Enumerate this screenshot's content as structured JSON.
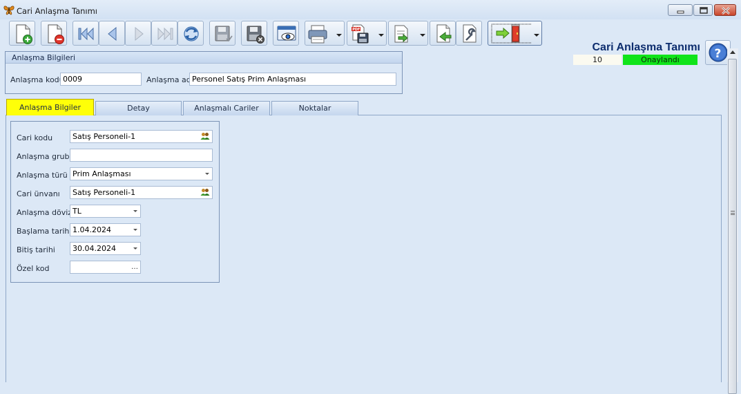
{
  "window": {
    "title": "Cari Anlaşma Tanımı",
    "icon": "butterfly-icon"
  },
  "toolbar": {
    "buttons": [
      {
        "name": "new-record",
        "icon": "new-document-icon"
      },
      {
        "name": "delete-record",
        "icon": "delete-document-icon"
      },
      {
        "name": "first-record",
        "icon": "first-record-icon"
      },
      {
        "name": "previous-record",
        "icon": "previous-record-icon"
      },
      {
        "name": "next-record",
        "icon": "next-record-icon"
      },
      {
        "name": "last-record",
        "icon": "last-record-icon"
      },
      {
        "name": "refresh",
        "icon": "refresh-icon"
      },
      {
        "name": "save",
        "icon": "save-icon"
      },
      {
        "name": "cancel-save",
        "icon": "cancel-save-icon"
      },
      {
        "name": "preview",
        "icon": "preview-icon"
      },
      {
        "name": "print",
        "icon": "printer-icon"
      },
      {
        "name": "export-pdf",
        "icon": "pdf-save-icon"
      },
      {
        "name": "transfer",
        "icon": "transfer-document-icon"
      },
      {
        "name": "import",
        "icon": "import-document-icon"
      },
      {
        "name": "tools",
        "icon": "wrench-icon"
      },
      {
        "name": "exit",
        "icon": "exit-door-icon"
      }
    ]
  },
  "header": {
    "form_title": "Cari Anlaşma Tanımı",
    "record_number": "10",
    "status": "Onaylandı",
    "status_color": "#10e41a"
  },
  "agreement_info": {
    "title": "Anlaşma Bilgileri",
    "code_label": "Anlaşma kodu",
    "code_value": "0009",
    "name_label": "Anlaşma adı",
    "name_value": "Personel Satış Prim Anlaşması"
  },
  "tabs": [
    {
      "label": "Anlaşma Bilgiler",
      "active": true
    },
    {
      "label": "Detay",
      "active": false
    },
    {
      "label": "Anlaşmalı Cariler",
      "active": false
    },
    {
      "label": "Noktalar",
      "active": false
    }
  ],
  "details": {
    "account_code": {
      "label": "Cari kodu",
      "value": "Satış Personeli-1"
    },
    "agreement_group": {
      "label": "Anlaşma grubu",
      "value": ""
    },
    "agreement_type": {
      "label": "Anlaşma türü",
      "value": "Prim Anlaşması"
    },
    "account_title": {
      "label": "Cari ünvanı",
      "value": "Satış Personeli-1"
    },
    "currency": {
      "label": "Anlaşma dövizi",
      "value": "TL"
    },
    "start_date": {
      "label": "Başlama tarihi",
      "value": "1.04.2024"
    },
    "end_date": {
      "label": "Bitiş tarihi",
      "value": "30.04.2024"
    },
    "special_code": {
      "label": "Özel kod",
      "value": ""
    }
  },
  "colors": {
    "active_tab": "#ffff08",
    "background": "#dce8f6",
    "title_text": "#0d2d6e"
  }
}
